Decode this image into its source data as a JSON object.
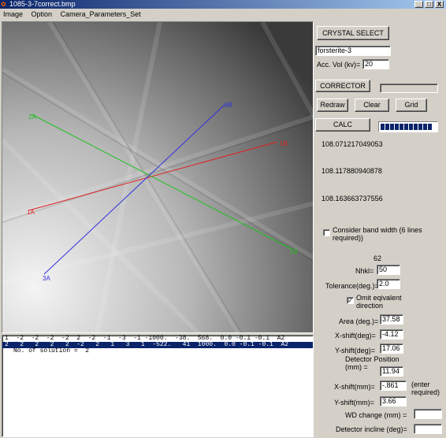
{
  "window": {
    "title": "1085-3-7correct.bmp",
    "controls": [
      "_",
      "□",
      "X"
    ]
  },
  "menu": [
    "Image",
    "Option",
    "Camera_Parameters_Set"
  ],
  "pattern": {
    "lines": [
      {
        "start_label": "1A",
        "end_label": "1B",
        "color": "#e02020"
      },
      {
        "start_label": "2A",
        "end_label": "2B",
        "color": "#20c020"
      },
      {
        "start_label": "3A",
        "end_label": "3B",
        "color": "#3030e0"
      }
    ]
  },
  "panel": {
    "crystal_select_label": "CRYSTAL SELECT",
    "crystal_name": "forsterite-3",
    "acc_vol_label": "Acc. Vol (kv)=",
    "acc_vol_value": "20",
    "corrector_label": "CORRECTOR",
    "corrector_field": "",
    "redraw_label": "Redraw",
    "clear_label": "Clear",
    "grid_label": "Grid",
    "calc_label": "CALC",
    "calc_progress": 1.0,
    "angles": [
      "108.071217049053",
      "108.117880940878",
      "108.163663737556"
    ],
    "band_width_label": "Consider band width (6 lines required))",
    "band_width_checked": false,
    "count_value": "62",
    "nhkl_label": "Nhkl=",
    "nhkl_value": "50",
    "tolerance_label": "Tolerance(deg.)=",
    "tolerance_value": "2.0",
    "omit_label": "Omit eqivalent direction",
    "omit_checked": true,
    "area_label": "Area (deg.)=",
    "area_value": "37.58",
    "xshift_deg_label": "X-shift(deg)=",
    "xshift_deg_value": "-4.12",
    "yshift_deg_label": "Y-shift(deg)=",
    "yshift_deg_value": "17.06",
    "detector_pos_label": "Detector Position (mm) =",
    "detector_pos_value": "11.94",
    "xshift_mm_label": "X-shift(mm)=",
    "xshift_mm_value": "-.861",
    "enter_required_label": "(enter required)",
    "yshift_mm_label": "Y-shift(mm)=",
    "yshift_mm_value": "3.66",
    "wd_change_label": "WD change (mm) =",
    "wd_change_value": "",
    "detector_incline_label": "Detector incline (deg)=",
    "detector_incline_value": ""
  },
  "results": {
    "rows": [
      "1  -2  -2  -2  -2  2  -2  -1  -3  -1 -1000.  -38.  568.  0.0 -0.1 -0.1  A2",
      "2   2   2   2   2  -2   2   1   3   1  -522.   41  1000.  0.0 -0.1 -0.1  A2"
    ],
    "selected_index": 1,
    "solution_text": "No. of solution =  2"
  }
}
